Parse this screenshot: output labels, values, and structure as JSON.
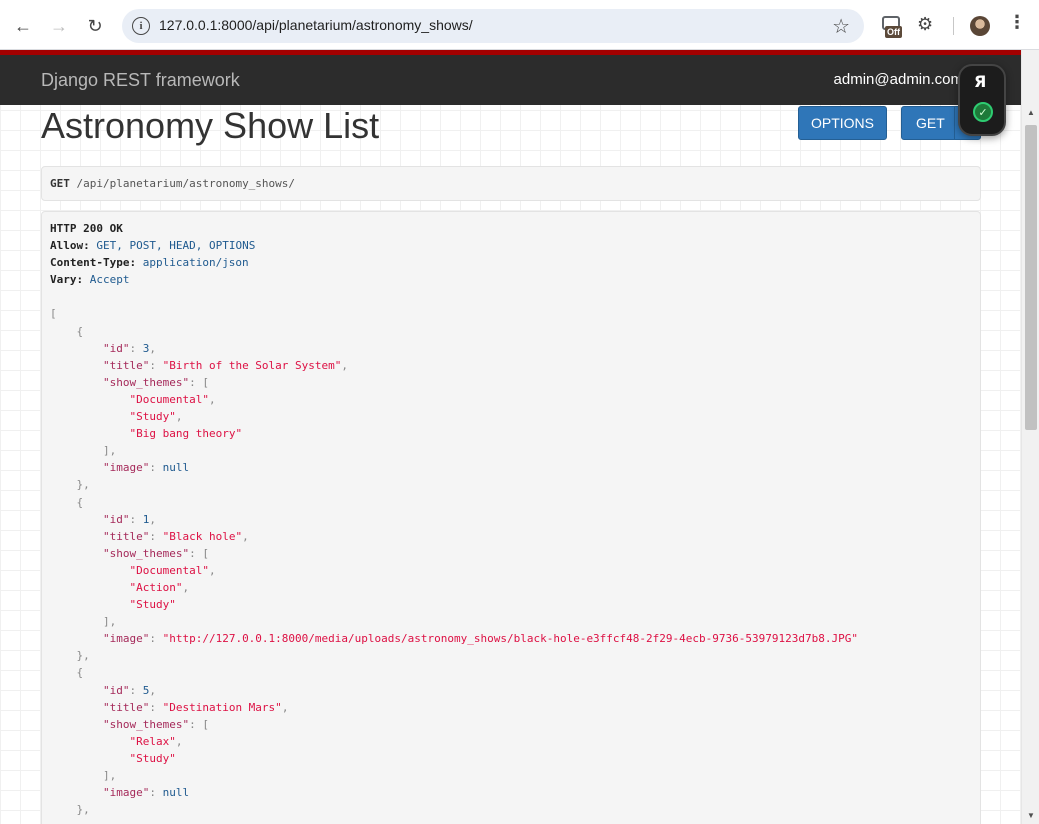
{
  "browser": {
    "url": "127.0.0.1:8000/api/planetarium/astronomy_shows/",
    "extension_badge": "Off"
  },
  "drf": {
    "brand": "Django REST framework",
    "user": "admin@admin.com"
  },
  "page": {
    "title": "Astronomy Show List",
    "options_label": "OPTIONS",
    "get_label": "GET"
  },
  "request": {
    "method": "GET",
    "path": "/api/planetarium/astronomy_shows/"
  },
  "response": {
    "status": "HTTP 200 OK",
    "headers": [
      {
        "name": "Allow:",
        "value": "GET, POST, HEAD, OPTIONS"
      },
      {
        "name": "Content-Type:",
        "value": "application/json"
      },
      {
        "name": "Vary:",
        "value": "Accept"
      }
    ],
    "shows": [
      {
        "id": "3",
        "title": "\"Birth of the Solar System\"",
        "show_themes": [
          "\"Documental\"",
          "\"Study\"",
          "\"Big bang theory\""
        ],
        "image": "null"
      },
      {
        "id": "1",
        "title": "\"Black hole\"",
        "show_themes": [
          "\"Documental\"",
          "\"Action\"",
          "\"Study\""
        ],
        "image": "\"http://127.0.0.1:8000/media/uploads/astronomy_shows/black-hole-e3ffcf48-2f29-4ecb-9736-53979123d7b8.JPG\""
      },
      {
        "id": "5",
        "title": "\"Destination Mars\"",
        "show_themes": [
          "\"Relax\"",
          "\"Study\""
        ],
        "image": "null"
      }
    ]
  }
}
